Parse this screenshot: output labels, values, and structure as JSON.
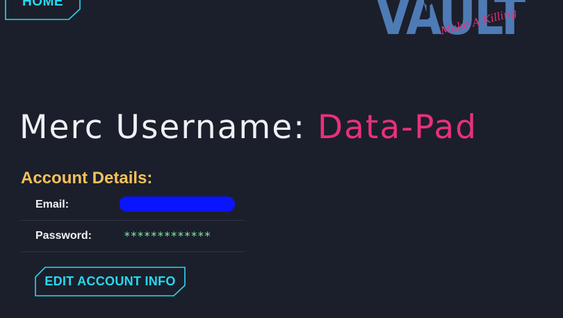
{
  "nav": {
    "home_label": "HOME"
  },
  "logo": {
    "wordmark": "VAULT",
    "tagline": "Make A Killing"
  },
  "title": {
    "prefix": "Merc Username:",
    "username": "Data-Pad"
  },
  "account": {
    "heading": "Account Details:",
    "rows": [
      {
        "label": "Email:",
        "value": ""
      },
      {
        "label": "Password:",
        "value": "*************"
      }
    ]
  },
  "actions": {
    "edit_label": "EDIT ACCOUNT INFO"
  },
  "colors": {
    "background": "#1b1f2b",
    "accent_cyan": "#27d9f2",
    "accent_pink": "#e8317a",
    "heading_gold": "#f5c15c",
    "value_green": "#7ff0a8",
    "logo_blue": "#4e7bb5",
    "redaction_blue": "#0a14ff"
  },
  "icons": {
    "logo": "vault-logo-icon"
  }
}
